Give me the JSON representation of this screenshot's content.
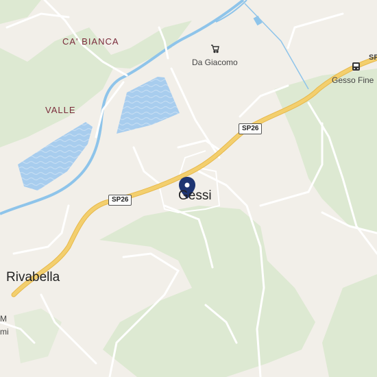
{
  "colors": {
    "land": "#f2efe9",
    "forest": "#dde9d2",
    "water": "#a8cdee",
    "river": "#8ec4ea",
    "highway": "#f3cf6e",
    "road": "#ffffff",
    "marker": "#1e3572"
  },
  "labels": {
    "ca_bianca": "CA' BIANCA",
    "valle": "VALLE",
    "da_giacomo": "Da Giacomo",
    "gesso_fine": "Gesso Fine",
    "gessi": "Gessi",
    "rivabella": "Rivabella",
    "edge_text": "SP",
    "edge_m": "M",
    "edge_mi": "mi"
  },
  "shields": {
    "sp26_north": "SP26",
    "sp26_south": "SP26"
  },
  "icons": {
    "location": "location-pin-icon",
    "shop": "shopping-cart-icon",
    "bus": "bus-stop-icon"
  }
}
